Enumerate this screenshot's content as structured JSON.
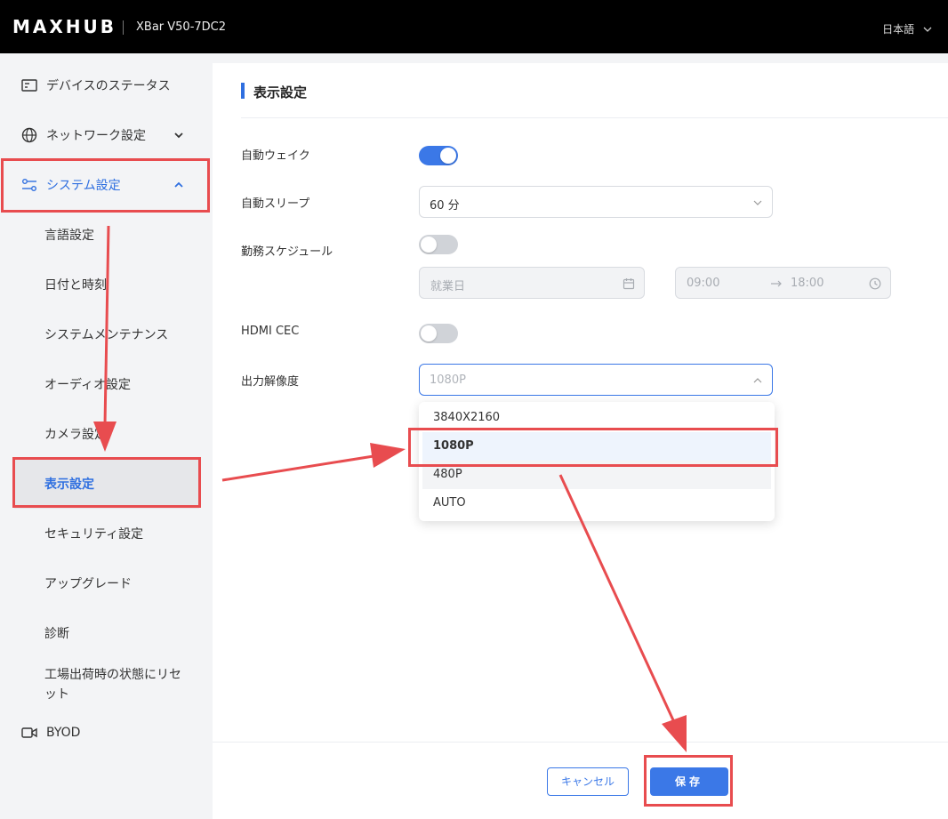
{
  "header": {
    "brand": "MAXHUB",
    "model": "XBar V50-7DC2",
    "language": "日本語"
  },
  "sidebar": {
    "items": [
      {
        "label": "デバイスのステータス",
        "icon": "status-icon"
      },
      {
        "label": "ネットワーク設定",
        "icon": "globe-icon"
      },
      {
        "label": "システム設定",
        "icon": "sliders-icon"
      }
    ],
    "subitems": [
      "言語設定",
      "日付と時刻",
      "システムメンテナンス",
      "オーディオ設定",
      "カメラ設定",
      "表示設定",
      "セキュリティ設定",
      "アップグレード",
      "診断",
      "工場出荷時の状態にリセット"
    ],
    "byod": {
      "label": "BYOD",
      "icon": "camera-icon"
    }
  },
  "main": {
    "title": "表示設定",
    "auto_wake": {
      "label": "自動ウェイク",
      "on": true
    },
    "auto_sleep": {
      "label": "自動スリープ",
      "value": "60 分"
    },
    "schedule": {
      "label": "勤務スケジュール",
      "on": false,
      "days_placeholder": "就業日",
      "start_time": "09:00",
      "end_time": "18:00"
    },
    "hdmi_cec": {
      "label": "HDMI CEC",
      "on": false
    },
    "output_resolution": {
      "label": "出力解像度",
      "placeholder": "1080P",
      "options": [
        "3840X2160",
        "1080P",
        "480P",
        "AUTO"
      ],
      "selected": "1080P"
    }
  },
  "footer": {
    "cancel": "キャンセル",
    "save": "保存"
  },
  "colors": {
    "accent": "#3b78e7",
    "annotation": "#e84c4f"
  }
}
